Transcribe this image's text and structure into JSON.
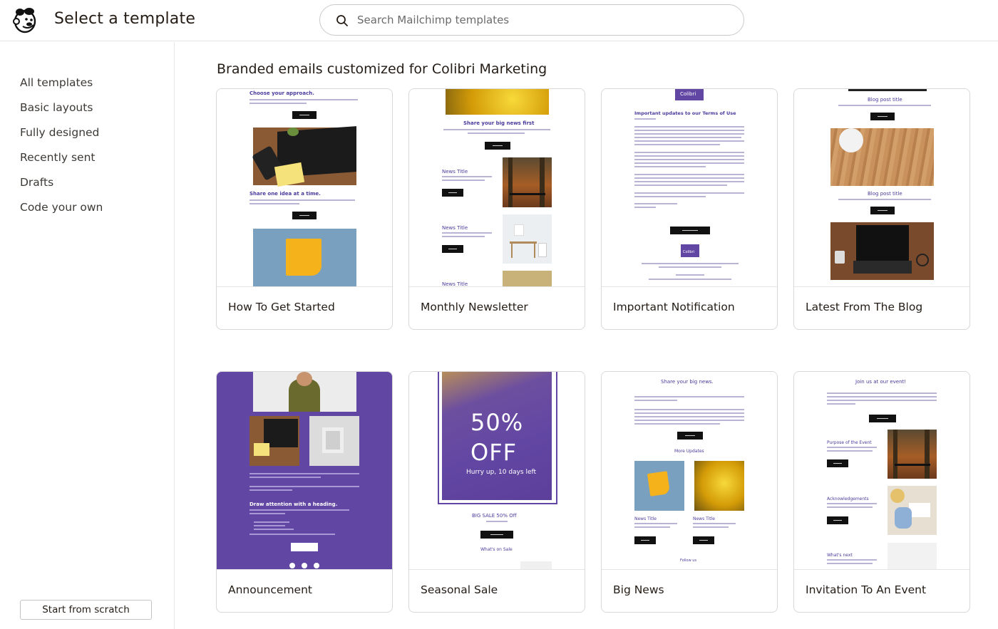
{
  "header": {
    "title": "Select a template",
    "search_placeholder": "Search Mailchimp templates"
  },
  "sidebar": {
    "items": [
      {
        "label": "All templates"
      },
      {
        "label": "Basic layouts"
      },
      {
        "label": "Fully designed"
      },
      {
        "label": "Recently sent"
      },
      {
        "label": "Drafts"
      },
      {
        "label": "Code your own"
      }
    ],
    "start_button": "Start from scratch"
  },
  "main": {
    "section_title": "Branded emails customized for Colibri Marketing",
    "cards": [
      {
        "label": "How To Get Started",
        "preview": {
          "heading1": "Choose your approach.",
          "heading2": "Share one idea at a time."
        }
      },
      {
        "label": "Monthly Newsletter",
        "preview": {
          "heading": "Share your big news first",
          "news1": "News Title",
          "news2": "News Title",
          "news3": "News Title"
        }
      },
      {
        "label": "Important Notification",
        "preview": {
          "brand": "Colibri",
          "heading": "Important updates to our Terms of Use",
          "footer_brand": "Colibri"
        }
      },
      {
        "label": "Latest From The Blog",
        "preview": {
          "post1": "Blog post title",
          "post2": "Blog post title"
        }
      },
      {
        "label": "Announcement",
        "preview": {
          "heading": "Draw attention with a heading."
        }
      },
      {
        "label": "Seasonal Sale",
        "preview": {
          "big1": "50%",
          "big2": "OFF",
          "sub": "Hurry up, 10 days left",
          "sale": "BIG SALE 50% Off",
          "whats_on": "What's on Sale"
        }
      },
      {
        "label": "Big News",
        "preview": {
          "heading": "Share your big news.",
          "more": "More Updates",
          "news1": "News Title",
          "news2": "News Title",
          "follow": "Follow us"
        }
      },
      {
        "label": "Invitation To An Event",
        "preview": {
          "heading": "Join us at our event!",
          "s1": "Purpose of the Event",
          "s2": "Acknowledgements",
          "s3": "What's next"
        }
      }
    ]
  },
  "colors": {
    "brand_purple": "#6246a3",
    "text_purple": "#4a3b9c",
    "accent_yellow": "#f5b400",
    "text_dark": "#241c15"
  }
}
